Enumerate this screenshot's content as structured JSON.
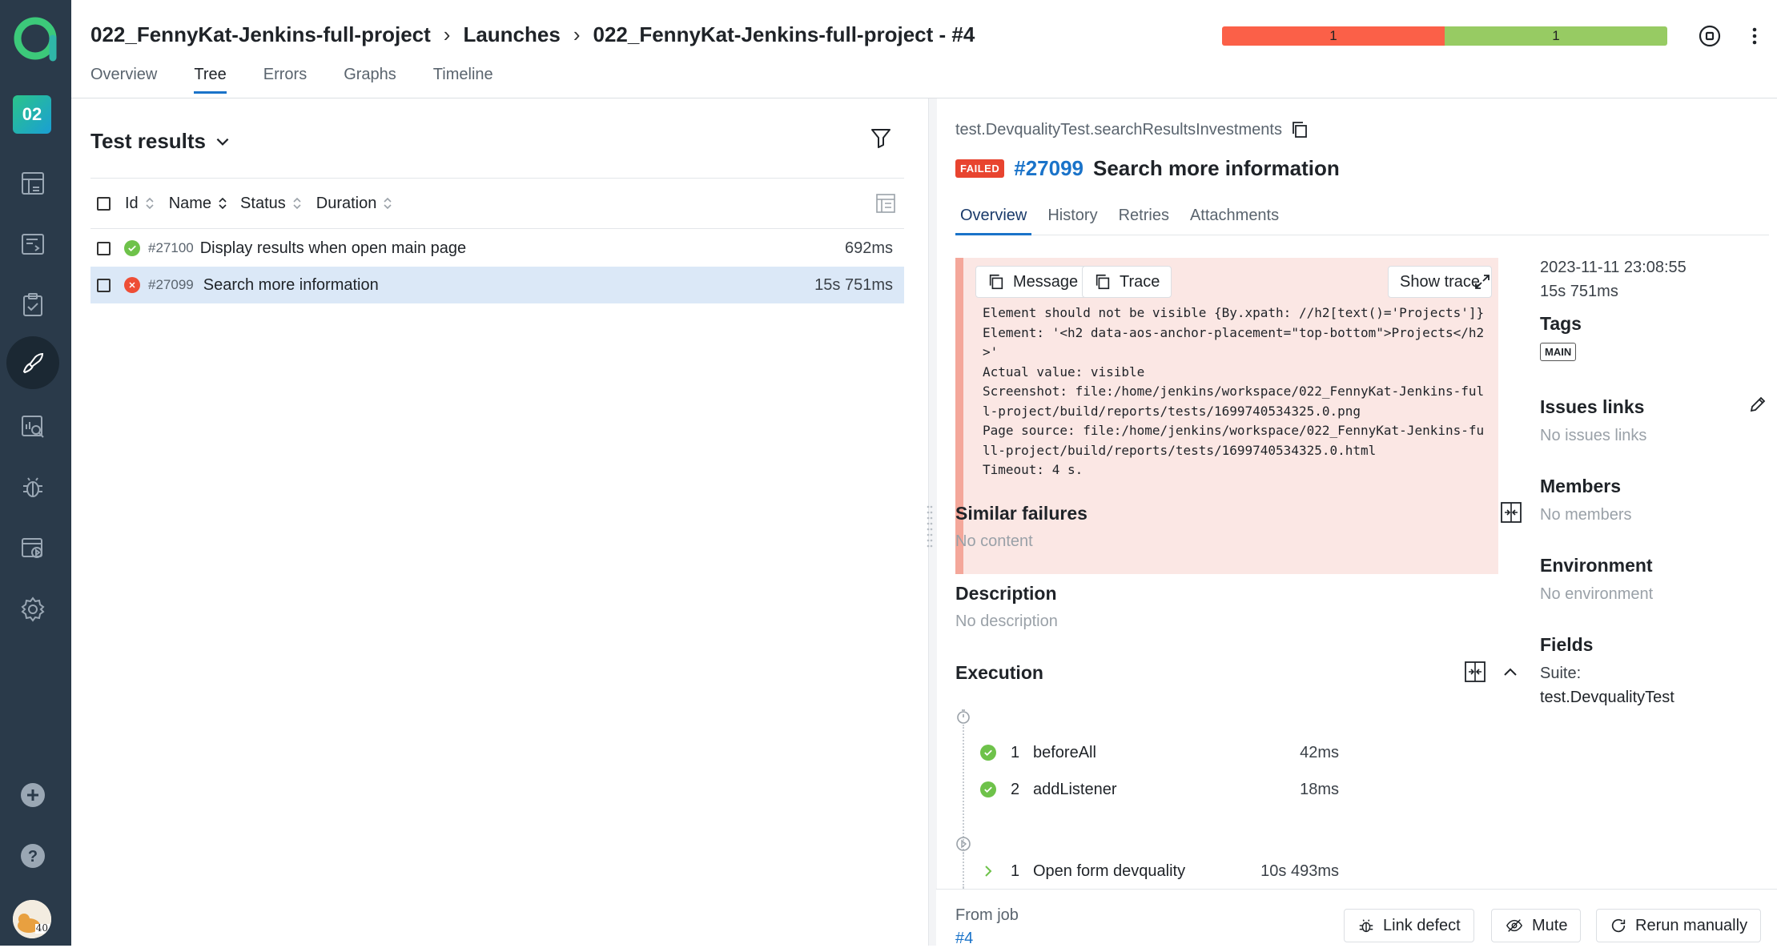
{
  "sidebar": {
    "project_badge": "02",
    "icons": [
      "dashboard-icon",
      "test-cases-icon",
      "test-plans-icon",
      "launches-icon",
      "analytics-icon",
      "defects-icon",
      "jobs-icon",
      "settings-icon"
    ],
    "bottom_icons": [
      "add-icon",
      "help-icon"
    ],
    "avatar_badge": "40"
  },
  "header": {
    "breadcrumb": [
      "022_FennyKat-Jenkins-full-project",
      "Launches",
      "022_FennyKat-Jenkins-full-project - #4"
    ],
    "stats": {
      "failed": "1",
      "passed": "1"
    },
    "tabs": [
      "Overview",
      "Tree",
      "Errors",
      "Graphs",
      "Timeline"
    ],
    "active_tab": "Tree"
  },
  "tree": {
    "title": "Test results",
    "columns": [
      "Id",
      "Name",
      "Status",
      "Duration"
    ],
    "rows": [
      {
        "id": "#27100",
        "name": "Display results when open main page",
        "status": "passed",
        "duration": "692ms"
      },
      {
        "id": "#27099",
        "name": "Search more information",
        "status": "failed",
        "duration": "15s 751ms"
      }
    ]
  },
  "test": {
    "fqn": "test.DevqualityTest.searchResultsInvestments",
    "status_badge": "FAILED",
    "id": "#27099",
    "name": "Search more information",
    "tabs": [
      "Overview",
      "History",
      "Retries",
      "Attachments"
    ],
    "active_tab": "Overview",
    "error_buttons": {
      "message": "Message",
      "trace": "Trace",
      "show_trace": "Show trace"
    },
    "error_lines": [
      "Element should not be visible {By.xpath: //h2[text()='Projects']}",
      "Element: '<h2 data-aos-anchor-placement=\"top-bottom\">Projects</h2",
      ">'",
      "Actual value: visible",
      "Screenshot: file:/home/jenkins/workspace/022_FennyKat-Jenkins-ful",
      "l-project/build/reports/tests/1699740534325.0.png",
      "Page source: file:/home/jenkins/workspace/022_FennyKat-Jenkins-fu",
      "ll-project/build/reports/tests/1699740534325.0.html",
      "Timeout: 4 s."
    ],
    "similar_failures": {
      "title": "Similar failures",
      "empty": "No content"
    },
    "description": {
      "title": "Description",
      "empty": "No description"
    },
    "execution": {
      "title": "Execution",
      "setup": [
        {
          "n": "1",
          "name": "beforeAll",
          "duration": "42ms"
        },
        {
          "n": "2",
          "name": "addListener",
          "duration": "18ms"
        }
      ],
      "steps": [
        {
          "n": "1",
          "name": "Open form devquality",
          "duration": "10s 493ms"
        }
      ]
    },
    "meta": {
      "datetime": "2023-11-11 23:08:55",
      "duration": "15s 751ms",
      "tags_label": "Tags",
      "tag": "MAIN",
      "issues_label": "Issues links",
      "issues_empty": "No issues links",
      "members_label": "Members",
      "members_empty": "No members",
      "environment_label": "Environment",
      "environment_empty": "No environment",
      "fields_label": "Fields",
      "field_suite_label": "Suite:",
      "field_suite_value": "test.DevqualityTest"
    },
    "footer": {
      "from_job_label": "From job",
      "job_link": "#4",
      "link_defect": "Link defect",
      "mute": "Mute",
      "rerun": "Rerun manually"
    }
  },
  "colors": {
    "sidebar": "#2a3a4a",
    "accent": "#1a73c9",
    "failed": "#fb6048",
    "passed": "#97cb63"
  }
}
